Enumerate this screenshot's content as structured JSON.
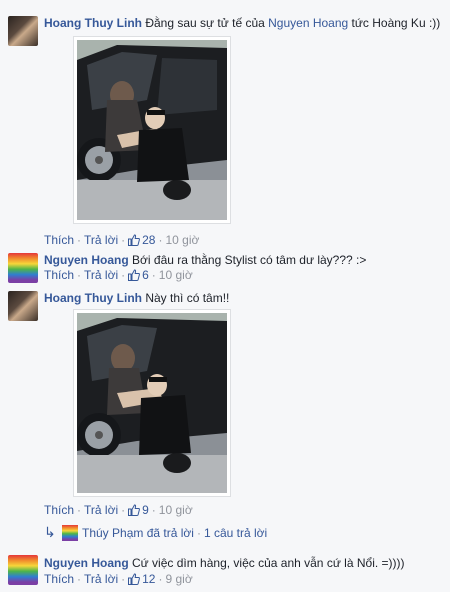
{
  "comments": [
    {
      "author": "Hoang Thuy Linh",
      "text": "Đằng sau sự tử tế của ",
      "mention": "Nguyen Hoang",
      "text_after": " tức Hoàng Ku :))",
      "actions": {
        "like": "Thích",
        "reply": "Trả lời",
        "likes": "28",
        "time": "10 giờ"
      }
    },
    {
      "author": "Nguyen Hoang",
      "text": "Bới đâu ra thằng Stylist có tâm dư lày??? :>",
      "actions": {
        "like": "Thích",
        "reply": "Trả lời",
        "likes": "6",
        "time": "10 giờ"
      }
    },
    {
      "author": "Hoang Thuy Linh",
      "text": "Này thì có tâm!!",
      "actions": {
        "like": "Thích",
        "reply": "Trả lời",
        "likes": "9",
        "time": "10 giờ"
      },
      "reply_summary": {
        "name": "Thúy Phạm",
        "verb": "đã trả lời",
        "count": "1 câu trả lời"
      }
    },
    {
      "author": "Nguyen Hoang",
      "text": "Cứ việc dìm hàng, việc của anh vẫn cứ là Nổi. =))))",
      "actions": {
        "like": "Thích",
        "reply": "Trả lời",
        "likes": "12",
        "time": "9 giờ"
      }
    }
  ],
  "separator": "·",
  "icons": {
    "like": "thumbs-up-icon",
    "reply_arrow": "reply-arrow-icon"
  },
  "colors": {
    "link": "#365899",
    "meta": "#90949c",
    "background": "#f6f7f9"
  }
}
